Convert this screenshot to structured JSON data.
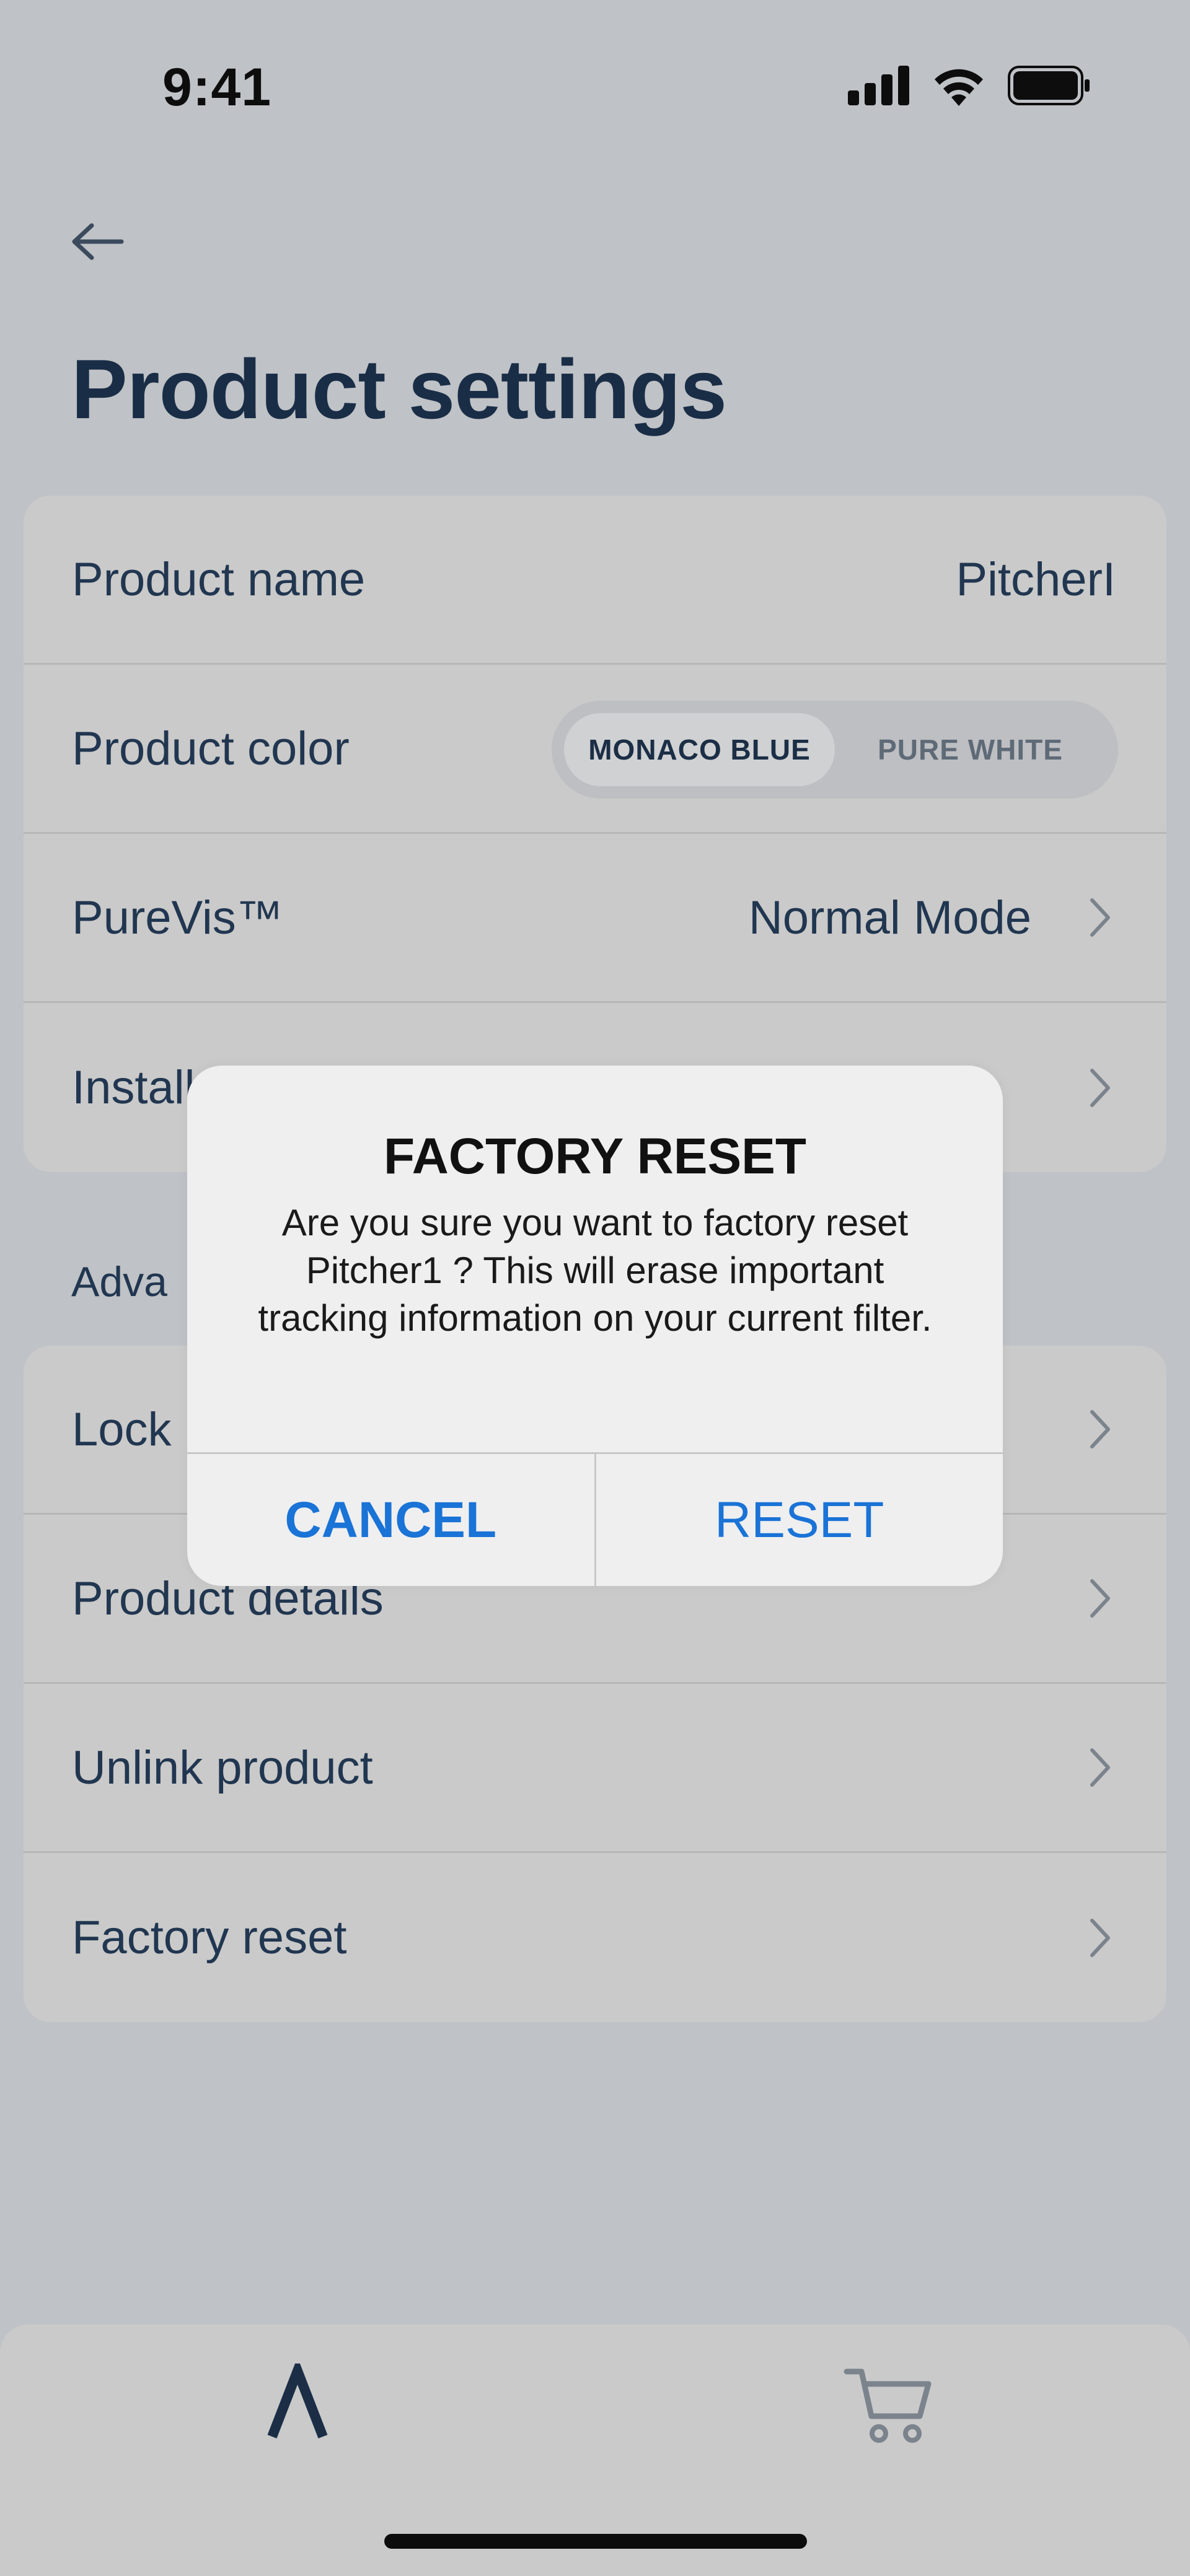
{
  "status_bar": {
    "time": "9:41"
  },
  "header": {
    "title": "Product settings"
  },
  "settings_group": {
    "product_name": {
      "label": "Product name",
      "value": "PitcherI"
    },
    "product_color": {
      "label": "Product color",
      "options": [
        "MONACO BLUE",
        "PURE WHITE"
      ],
      "selected": "MONACO BLUE"
    },
    "purevis": {
      "label": "PureVis™",
      "value": "Normal Mode"
    },
    "install": {
      "label": "Install"
    }
  },
  "advanced": {
    "header": "Adva",
    "items": [
      {
        "label": "Lock"
      },
      {
        "label": "Product details"
      },
      {
        "label": "Unlink product"
      },
      {
        "label": "Factory reset"
      }
    ]
  },
  "alert": {
    "title": "FACTORY RESET",
    "message": "Are you sure you want to factory reset Pitcher1 ? This will erase important tracking information on your current filter.",
    "cancel_label": "CANCEL",
    "reset_label": "RESET"
  },
  "tab_bar": {
    "tabs": [
      {
        "icon": "lambda-icon"
      },
      {
        "icon": "cart-icon"
      }
    ]
  },
  "colors": {
    "background": "#bfc2c6",
    "card": "#cacaca",
    "text": "#213650",
    "alert_button": "#1a73d6"
  }
}
